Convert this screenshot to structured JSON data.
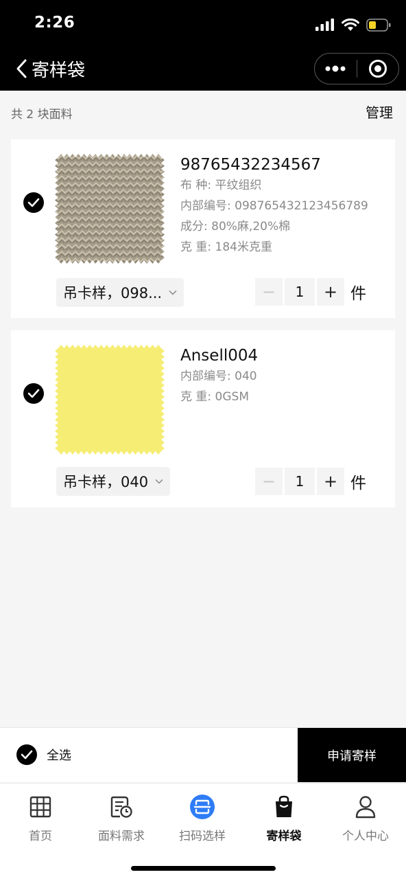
{
  "status_bar": {
    "time": "2:26"
  },
  "nav": {
    "title": "寄样袋"
  },
  "summary": {
    "count_text": "共 2 块面料",
    "manage_label": "管理"
  },
  "items": [
    {
      "title": "98765432234567",
      "lines": [
        "布 种: 平纹组织",
        "内部编号: 098765432123456789",
        "成分:  80%麻,20%棉",
        "克 重: 184米克重"
      ],
      "spec": "吊卡样，098...",
      "quantity": "1",
      "unit": "件",
      "swatch_color": "#a39a87",
      "checked": true
    },
    {
      "title": "Ansell004",
      "lines": [
        "内部编号: 040",
        "克 重: 0GSM"
      ],
      "spec": "吊卡样，040",
      "quantity": "1",
      "unit": "件",
      "swatch_color": "#f6ed74",
      "checked": true
    }
  ],
  "stepper": {
    "minus": "−",
    "plus": "+"
  },
  "action_bar": {
    "select_all_label": "全选",
    "apply_label": "申请寄样"
  },
  "tabbar": {
    "tabs": [
      {
        "label": "首页",
        "icon": "grid-icon"
      },
      {
        "label": "面料需求",
        "icon": "document-clock-icon"
      },
      {
        "label": "扫码选样",
        "icon": "scan-icon"
      },
      {
        "label": "寄样袋",
        "icon": "bag-icon",
        "active": true
      },
      {
        "label": "个人中心",
        "icon": "person-icon"
      }
    ]
  },
  "colors": {
    "accent_blue": "#2f7cf6",
    "black": "#000000"
  }
}
